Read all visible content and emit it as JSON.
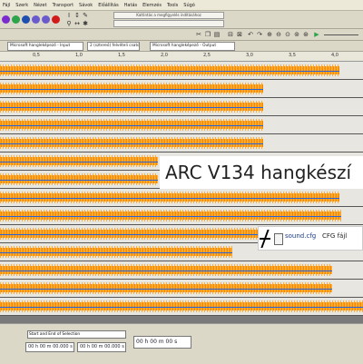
{
  "menu": [
    "Fájl",
    "Szerk",
    "Nézet",
    "Transport",
    "Sávok",
    "Előállítás",
    "Hatás",
    "Elemzés",
    "Tools",
    "Súgó"
  ],
  "meter_hint": "Kattintás a megfigyelés indításához",
  "devices": {
    "input_host": "Microsoft hangleképező - Input",
    "channels": "2 (sztereó) felvételi csatorna",
    "output": "Microsoft hangleképező - Output"
  },
  "ruler_ticks": [
    "0,5",
    "1,0",
    "1,5",
    "2,0",
    "2,5",
    "3,0",
    "3,5",
    "4,0"
  ],
  "overlay_title": "ARC V134 hangkészí",
  "file_label": {
    "name": "sound.cfg",
    "type": "CFG fájl"
  },
  "bottom": {
    "selection_mode": "Start and End of Selection",
    "start_time": "00 h 00 m 00.000 s",
    "end_time": "00 h 00 m 00.000 s",
    "position": "00 h 00 m 00.000 s",
    "big_time": "00 h 00 m 00 s"
  },
  "colors": {
    "waveform": "#ff9c1a",
    "center_line": "#2a63d8"
  }
}
